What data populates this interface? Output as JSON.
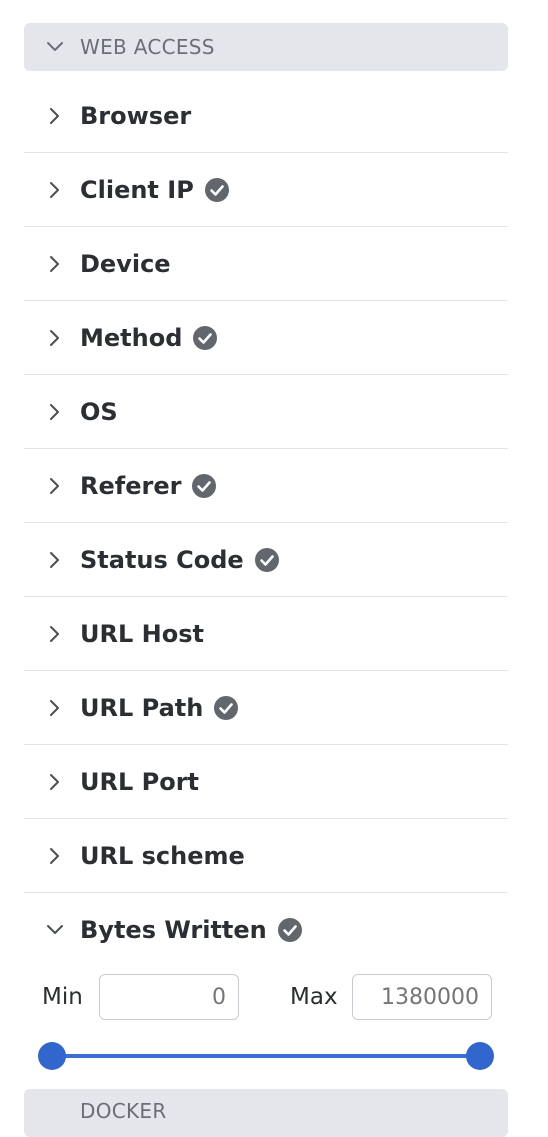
{
  "section": {
    "title": "WEB ACCESS",
    "expanded": true
  },
  "fields": [
    {
      "label": "Browser",
      "verified": false
    },
    {
      "label": "Client IP",
      "verified": true
    },
    {
      "label": "Device",
      "verified": false
    },
    {
      "label": "Method",
      "verified": true
    },
    {
      "label": "OS",
      "verified": false
    },
    {
      "label": "Referer",
      "verified": true
    },
    {
      "label": "Status Code",
      "verified": true
    },
    {
      "label": "URL Host",
      "verified": false
    },
    {
      "label": "URL Path",
      "verified": true
    },
    {
      "label": "URL Port",
      "verified": false
    },
    {
      "label": "URL scheme",
      "verified": false
    },
    {
      "label": "Bytes Written",
      "verified": true,
      "expanded": true
    }
  ],
  "range": {
    "min_label": "Min",
    "max_label": "Max",
    "min_placeholder": "0",
    "max_placeholder": "1380000",
    "low_fraction": 0,
    "high_fraction": 1
  },
  "next_section": {
    "title": "DOCKER"
  },
  "colors": {
    "accent": "#3366cc",
    "check": "#62666d",
    "header_bg": "#e4e6eb"
  },
  "icons": {
    "collapsed": "chevron-right-icon",
    "expanded": "chevron-down-icon",
    "verified": "check-circle-icon"
  }
}
